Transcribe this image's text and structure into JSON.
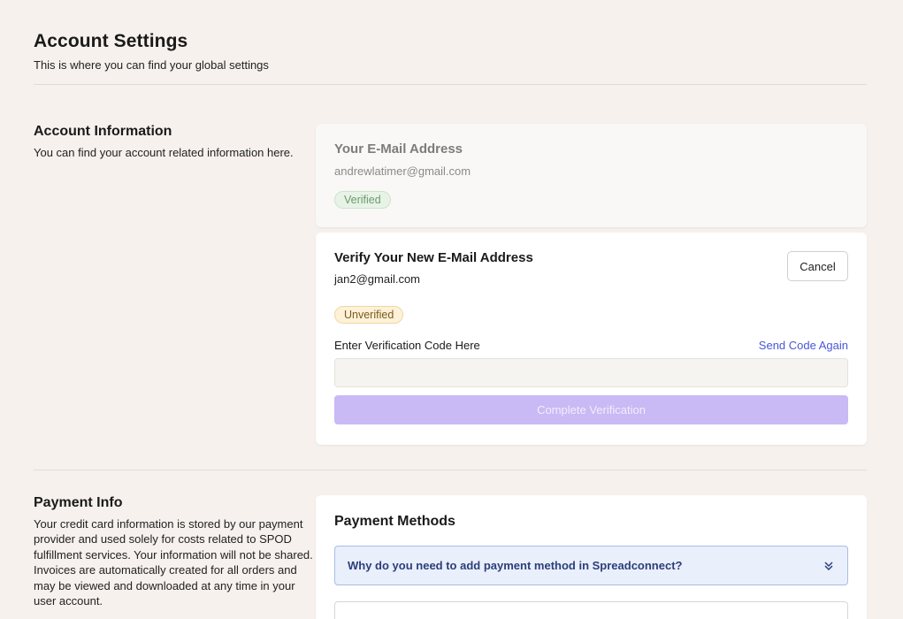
{
  "header": {
    "title": "Account Settings",
    "subtitle": "This is where you can find your global settings"
  },
  "account_info": {
    "title": "Account Information",
    "description": "You can find your account related information here.",
    "current_email": {
      "label": "Your E-Mail Address",
      "value": "andrewlatimer@gmail.com",
      "status": "Verified"
    },
    "new_email": {
      "title": "Verify Your New E-Mail Address",
      "value": "jan2@gmail.com",
      "status": "Unverified",
      "cancel_label": "Cancel",
      "code_label": "Enter Verification Code Here",
      "send_again_label": "Send Code Again",
      "code_value": "",
      "complete_label": "Complete Verification"
    }
  },
  "payment_info": {
    "title": "Payment Info",
    "description": "Your credit card information is stored by our payment provider and used solely for costs related to SPOD fulfillment services. Your information will not be shared. Invoices are automatically created for all orders and may be viewed and downloaded at any time in your user account.",
    "card_title": "Payment Methods",
    "faq_question": "Why do you need to add payment method in Spreadconnect?",
    "faq_icon": "chevrons-down-icon"
  },
  "colors": {
    "background": "#f6f1ec",
    "accent": "#c9b9f4",
    "link": "#4a57d6",
    "faq_bg": "#e9effb"
  }
}
